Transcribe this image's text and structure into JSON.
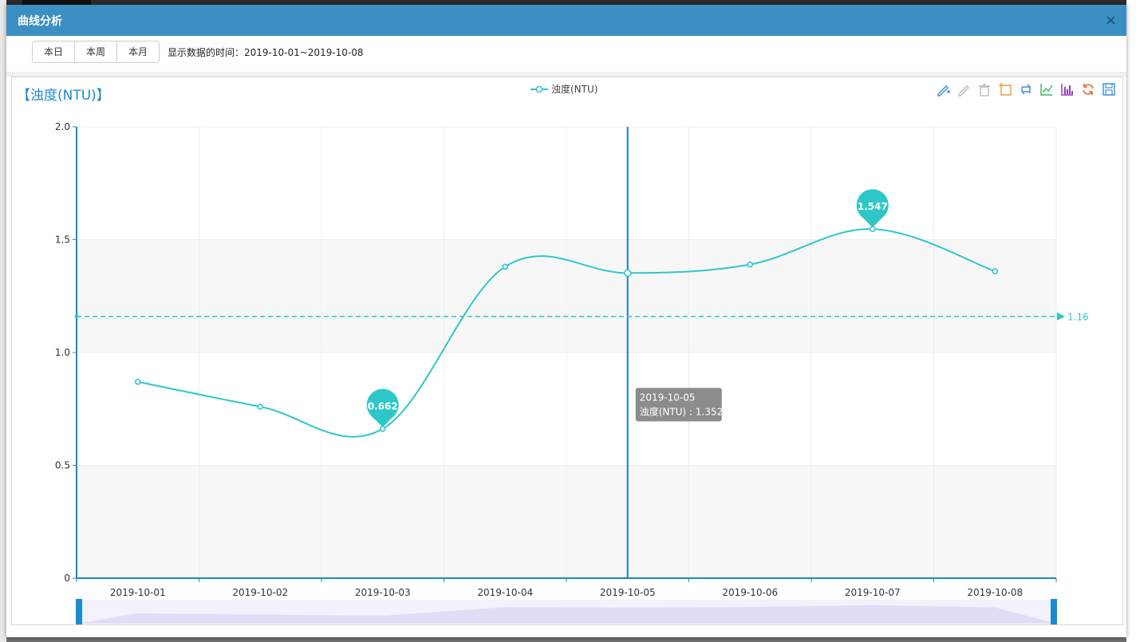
{
  "dialog": {
    "title": "曲线分析",
    "close_label": "×"
  },
  "toolbar": {
    "buttons": [
      "本日",
      "本周",
      "本月"
    ],
    "range_label": "显示数据的时间：2019-10-01~2019-10-08"
  },
  "tooltip": {
    "date": "2019-10-05",
    "text": "浊度(NTU) : 1.352"
  },
  "colors": {
    "series": "#2ec7c9",
    "axis": "#1a8bbd",
    "tooltip_bg": "#8c8c8c",
    "title": "#1d8bd1"
  },
  "tools": [
    "mark-line-icon",
    "mark-undo-icon",
    "mark-clear-icon",
    "data-zoom-icon",
    "zoom-reset-icon",
    "line-chart-icon",
    "bar-chart-icon",
    "restore-icon",
    "save-image-icon"
  ],
  "chart_data": {
    "type": "line",
    "title": "【浊度(NTU)】",
    "legend": [
      "浊度(NTU)"
    ],
    "legend_position": "top-center",
    "categories": [
      "2019-10-01",
      "2019-10-02",
      "2019-10-03",
      "2019-10-04",
      "2019-10-05",
      "2019-10-06",
      "2019-10-07",
      "2019-10-08"
    ],
    "series": [
      {
        "name": "浊度(NTU)",
        "values": [
          0.87,
          0.76,
          0.662,
          1.38,
          1.352,
          1.39,
          1.547,
          1.36
        ],
        "smooth": true
      }
    ],
    "y_ticks": [
      "0",
      "0.5",
      "1.0",
      "1.5",
      "2.0"
    ],
    "ylim": [
      0,
      2.0
    ],
    "mark_points": [
      {
        "label": "0.662",
        "value": 0.662,
        "index": 2
      },
      {
        "label": "1.547",
        "value": 1.547,
        "index": 6
      }
    ],
    "mark_line": {
      "label": "1.16",
      "value": 1.16
    },
    "highlight_index": 4,
    "grid": true
  }
}
